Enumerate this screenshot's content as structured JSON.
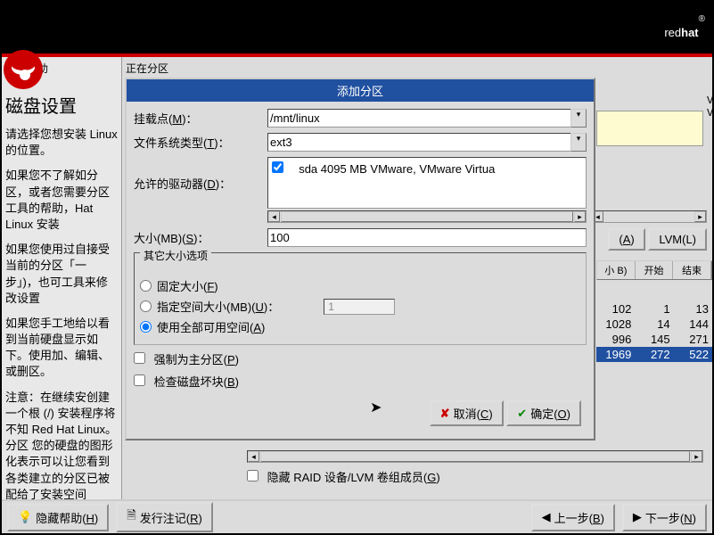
{
  "brand": {
    "light": "red",
    "bold": "hat"
  },
  "help": {
    "pane_label": "在线帮助",
    "title": "磁盘设置",
    "paragraphs": [
      "请选择您想安装 Linux 的位置。",
      "如果您不了解如分区，或者您需要分区工具的帮助，Hat Linux 安装",
      "如果您使用过自接受当前的分区「一步」)，也可工具来修改设置",
      "如果您手工地给以看到当前硬盘显示如下。使用加、编辑、或删区。",
      "注意：在继续安创建一个根 (/) 安装程序将不知 Red Hat Linux。分区 您的硬盘的图形化表示可以让您看到各类建立的分区已被配给了安装空间"
    ]
  },
  "main": {
    "label": "正在分区",
    "disk_label": "VMware Virtual",
    "buttons": {
      "a": "A",
      "lvm": "LVM(L)"
    },
    "table": {
      "headers": [
        "小 B)",
        "开始",
        "结束"
      ],
      "rows": [
        {
          "a": "102",
          "b": "1",
          "c": "13"
        },
        {
          "a": "1028",
          "b": "14",
          "c": "144"
        },
        {
          "a": "996",
          "b": "145",
          "c": "271"
        },
        {
          "a": "1969",
          "b": "272",
          "c": "522"
        }
      ]
    },
    "hide_members": "隐藏 RAID 设备/LVM 卷组成员(G)"
  },
  "dialog": {
    "title": "添加分区",
    "mount_label": "挂载点(M)：",
    "mount_value": "/mnt/linux",
    "fs_label": "文件系统类型(T)：",
    "fs_value": "ext3",
    "drives_label": "允许的驱动器(D)：",
    "drive_item": "sda     4095 MB VMware, VMware Virtua",
    "size_label": "大小(MB)(S)：",
    "size_value": "100",
    "options_legend": "其它大小选项",
    "radio_fixed": "固定大小(F)",
    "radio_upto": "指定空间大小(MB)(U)：",
    "radio_upto_val": "1",
    "radio_all": "使用全部可用空间(A)",
    "check_primary": "强制为主分区(P)",
    "check_badblocks": "检查磁盘坏块(B)",
    "btn_cancel": "取消(C)",
    "btn_ok": "确定(O)"
  },
  "bottom": {
    "hide_help": "隐藏帮助(H)",
    "release_notes": "发行注记(R)",
    "back": "上一步(B)",
    "next": "下一步(N)"
  }
}
